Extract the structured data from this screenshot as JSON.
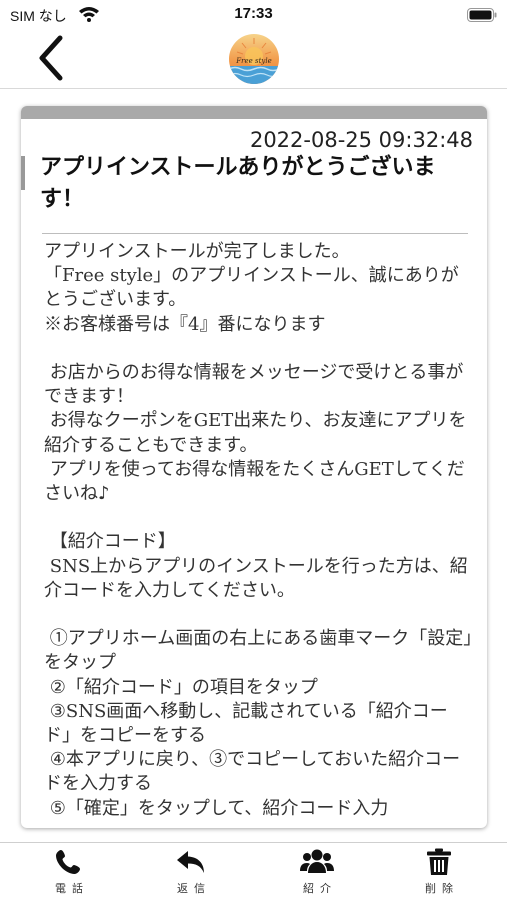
{
  "status_bar": {
    "carrier": "SIM なし",
    "time": "17:33"
  },
  "nav": {
    "back_icon": "chevron-left-icon",
    "logo_text": "Free style"
  },
  "message": {
    "date": "2022-08-25 09:32:48",
    "title": "アプリインストールありがとうございます！",
    "body": "アプリインストールが完了しました。\n「Free style」のアプリインストール、誠にありがとうございます。\n※お客様番号は『4』番になります\n\n お店からのお得な情報をメッセージで受けとる事ができます！\n お得なクーポンをGET出来たり、お友達にアプリを紹介することもできます。\n アプリを使ってお得な情報をたくさんGETしてくださいね♪\n\n 【紹介コード】\n SNS上からアプリのインストールを行った方は、紹介コードを入力してください。\n\n ①アプリホーム画面の右上にある歯車マーク「設定」をタップ\n ②「紹介コード」の項目をタップ\n ③SNS画面へ移動し、記載されている「紹介コード」をコピーをする\n ④本アプリに戻り、③でコピーしておいた紹介コードを入力する\n ⑤「確定」をタップして、紹介コード入力"
  },
  "tabs": [
    {
      "label": "電話",
      "icon": "phone-icon"
    },
    {
      "label": "返信",
      "icon": "reply-icon"
    },
    {
      "label": "紹介",
      "icon": "users-icon"
    },
    {
      "label": "削除",
      "icon": "trash-icon"
    }
  ],
  "colors": {
    "card_top_bar": "#a9a9a9",
    "title_accent": "#999999",
    "text": "#333333"
  }
}
